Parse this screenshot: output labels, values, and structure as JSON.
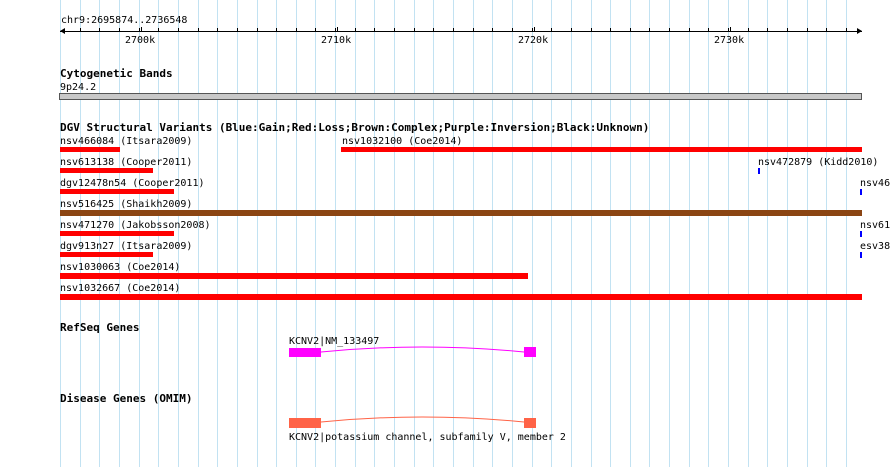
{
  "locus": "chr9:2695874..2736548",
  "ruler": {
    "labels": [
      "2700k",
      "2710k",
      "2720k",
      "2730k"
    ]
  },
  "tracks": {
    "cytogenetic": {
      "title": "Cytogenetic Bands",
      "band_label": "9p24.2"
    },
    "dgv": {
      "title": "DGV Structural Variants (Blue:Gain;Red:Loss;Brown:Complex;Purple:Inversion;Black:Unknown)",
      "features": [
        {
          "id": "f1",
          "label": "nsv466084 (Itsara2009)",
          "type": "loss"
        },
        {
          "id": "f2",
          "label": "nsv1032100 (Coe2014)",
          "type": "loss"
        },
        {
          "id": "f3",
          "label": "nsv613138 (Cooper2011)",
          "type": "loss"
        },
        {
          "id": "f4",
          "label": "nsv472879 (Kidd2010)",
          "type": "gain"
        },
        {
          "id": "f5",
          "label": "dgv12478n54 (Cooper2011)",
          "type": "loss"
        },
        {
          "id": "f6",
          "label": "nsv46",
          "type": "gain"
        },
        {
          "id": "f7",
          "label": "nsv516425 (Shaikh2009)",
          "type": "complex"
        },
        {
          "id": "f8",
          "label": "nsv471270 (Jakobsson2008)",
          "type": "loss"
        },
        {
          "id": "f9",
          "label": "nsv61",
          "type": "gain"
        },
        {
          "id": "f10",
          "label": "dgv913n27 (Itsara2009)",
          "type": "loss"
        },
        {
          "id": "f11",
          "label": "esv38",
          "type": "gain"
        },
        {
          "id": "f12",
          "label": "nsv1030063 (Coe2014)",
          "type": "loss"
        },
        {
          "id": "f13",
          "label": "nsv1032667 (Coe2014)",
          "type": "loss"
        }
      ]
    },
    "refseq": {
      "title": "RefSeq Genes",
      "gene_label": "KCNV2|NM_133497"
    },
    "omim": {
      "title": "Disease Genes (OMIM)",
      "gene_label": "KCNV2|potassium channel, subfamily V, member 2"
    }
  },
  "colors": {
    "gridline": "#c2e2f2",
    "loss": "#ff0000",
    "gain": "#0000ff",
    "complex": "#8b4513",
    "refseq": "#ff00ff",
    "omim": "#ff6347",
    "band_fill": "#c8c8c8"
  }
}
